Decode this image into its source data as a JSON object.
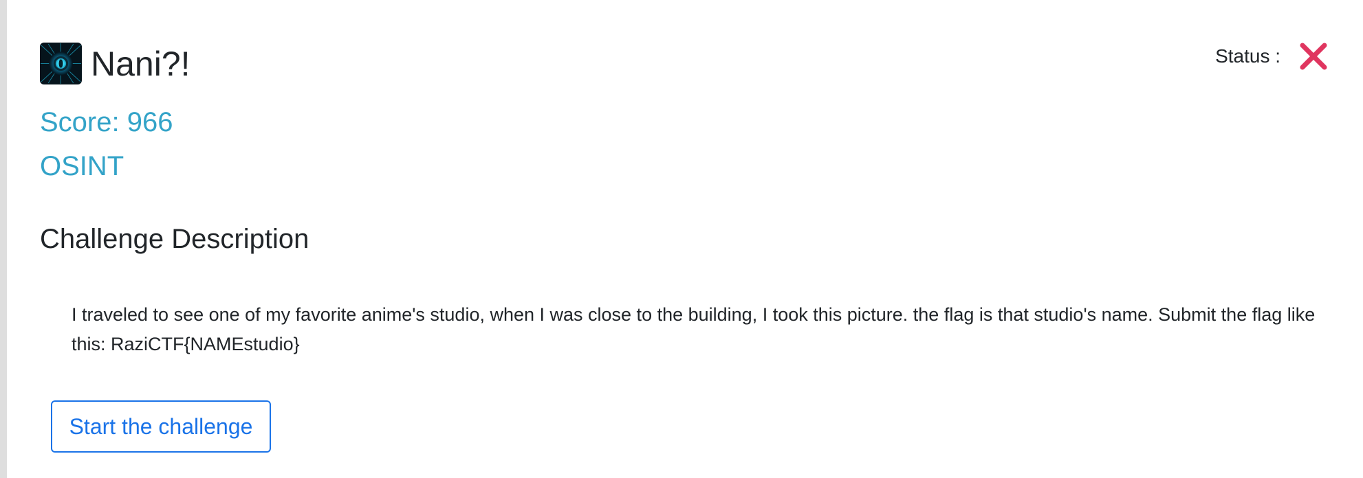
{
  "challenge": {
    "title": "Nani?!",
    "icon": "glowing-eye-icon",
    "score_text": "Score: 966",
    "category": "OSINT"
  },
  "status": {
    "label": "Status :",
    "icon": "red-x-icon",
    "color": "#e0355f"
  },
  "description": {
    "heading": "Challenge Description",
    "text": "I traveled to see one of my favorite anime's studio, when I was close to the building, I took this picture. the flag is that studio's name.   Submit the flag like this: RaziCTF{NAMEstudio}"
  },
  "actions": {
    "start_label": "Start the challenge"
  },
  "colors": {
    "accent": "#33a3c8",
    "button": "#1a73e8",
    "status_fail": "#e0355f"
  }
}
